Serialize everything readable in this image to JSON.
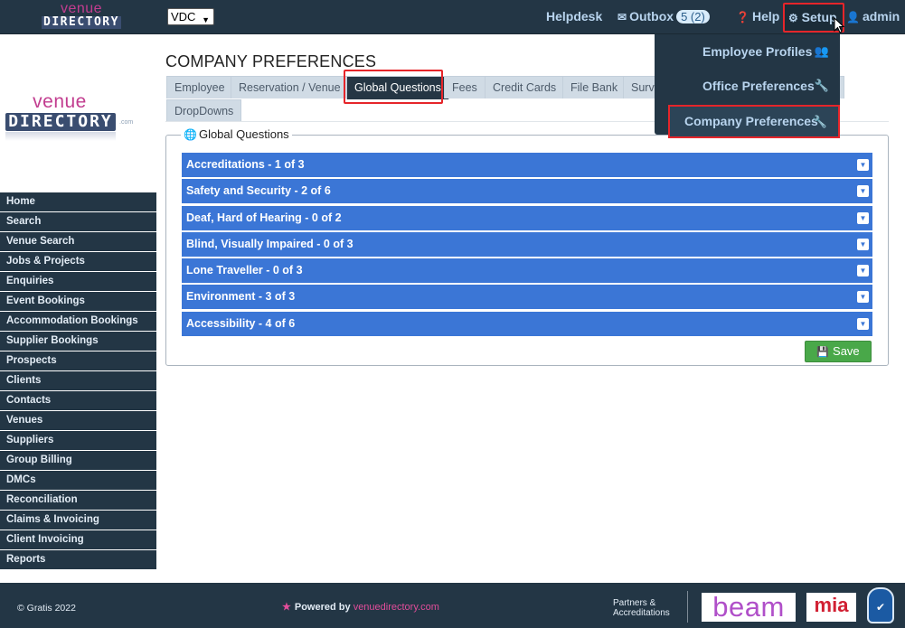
{
  "header": {
    "logo_line1": "venue",
    "logo_line2": "DIRECTORY",
    "company_select_value": "VDC",
    "helpdesk": "Helpdesk",
    "outbox_label": "Outbox",
    "outbox_count": "5 (2)",
    "help": "Help",
    "setup": "Setup",
    "user": "admin"
  },
  "setup_menu": {
    "items": [
      {
        "label": "Employee Profiles",
        "icon": "users-icon"
      },
      {
        "label": "Office Preferences",
        "icon": "wrench-icon"
      },
      {
        "label": "Company Preferences",
        "icon": "wrench-icon"
      }
    ]
  },
  "side_logo": {
    "line1": "venue",
    "line2": "DIRECTORY",
    "suffix": ".com"
  },
  "sidebar": {
    "items": [
      "Home",
      "Search",
      "Venue Search",
      "Jobs & Projects",
      "Enquiries",
      "Event Bookings",
      "Accommodation Bookings",
      "Supplier Bookings",
      "Prospects",
      "Clients",
      "Contacts",
      "Venues",
      "Suppliers",
      "Group Billing",
      "DMCs",
      "Reconciliation",
      "Claims & Invoicing",
      "Client Invoicing",
      "Reports"
    ]
  },
  "main": {
    "title": "COMPANY PREFERENCES",
    "tabs": [
      "Employee",
      "Reservation / Venue",
      "Global Questions",
      "Fees",
      "Credit Cards",
      "File Bank",
      "Surv",
      "DropDowns"
    ],
    "active_tab": "Global Questions",
    "section_legend": "Global Questions",
    "accordion": [
      "Accreditations - 1 of 3",
      "Safety and Security - 2 of 6",
      "Deaf, Hard of Hearing - 0 of 2",
      "Blind, Visually Impaired - 0 of 3",
      "Lone Traveller - 0 of 3",
      "Environment - 3 of 3",
      "Accessibility - 4 of 6"
    ],
    "save_label": "Save"
  },
  "footer": {
    "copyright": "© Gratis 2022",
    "powered_prefix": "Powered by",
    "powered_brand": "venuedirectory.com",
    "partners_line1": "Partners &",
    "partners_line2": "Accreditations",
    "beam_logo": "beam",
    "mia_logo": "mia",
    "cyber_badge": "✔"
  },
  "colors": {
    "navy": "#233645",
    "accordion_blue": "#3b76d6",
    "save_green": "#49a849",
    "highlight_red": "#e5252a",
    "brand_pink": "#c23d8f"
  }
}
